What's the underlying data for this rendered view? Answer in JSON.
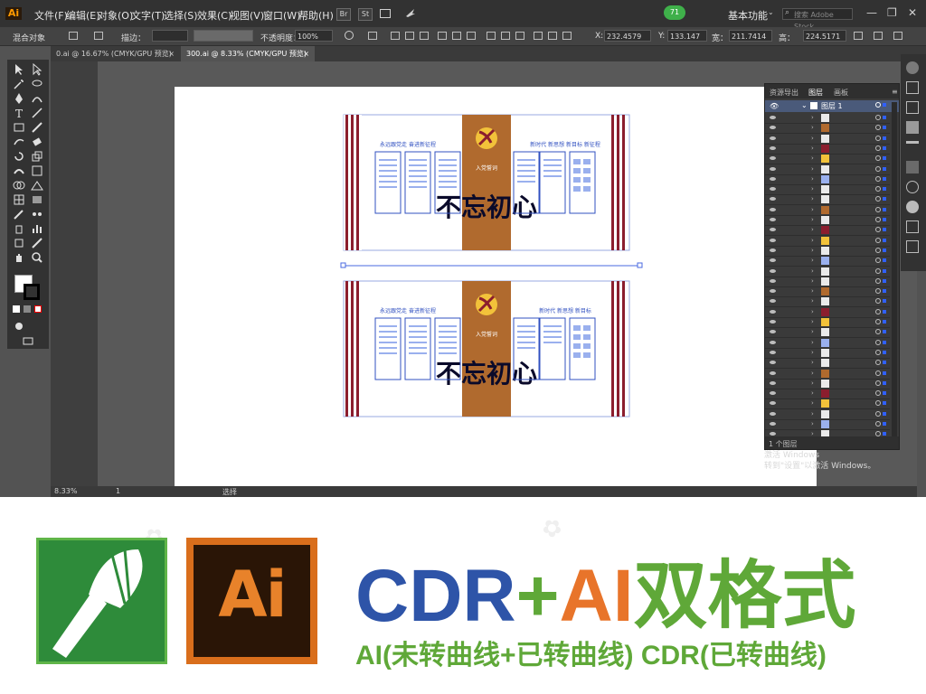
{
  "app": {
    "logo": "Ai"
  },
  "menubar": {
    "items": [
      "文件(F)",
      "编辑(E)",
      "对象(O)",
      "文字(T)",
      "选择(S)",
      "效果(C)",
      "视图(V)",
      "窗口(W)",
      "帮助(H)"
    ],
    "br_label": "Br",
    "st_label": "St",
    "badge": "71",
    "workspace": "基本功能",
    "search_placeholder": "搜索 Adobe Stock"
  },
  "control_bar": {
    "object_type": "混合对象",
    "stroke_label": "描边：",
    "opacity_label": "不透明度：",
    "opacity_value": "100%",
    "x_label": "X:",
    "x_value": "232.4579",
    "y_label": "Y:",
    "y_value": "133.147",
    "w_label": "宽：",
    "w_value": "211.7414",
    "h_label": "高：",
    "h_value": "224.5171"
  },
  "tabs": [
    {
      "label": "0.ai @ 16.67% (CMYK/GPU 预览)",
      "close": "×"
    },
    {
      "label": "300.ai @ 8.33% (CMYK/GPU 预览)",
      "close": "×"
    }
  ],
  "status_bar": {
    "zoom": "8.33%",
    "page": "1",
    "tool": "选择"
  },
  "layers_panel": {
    "tabs": [
      "资源导出",
      "图层",
      "画板"
    ],
    "layer_name": "图层 1",
    "footer": "1 个图层"
  },
  "activation": {
    "line1": "激活 Windows",
    "line2": "转到\"设置\"以激活 Windows。"
  },
  "artwork": {
    "top_left_heading": "永远跟党走 奋进新征程",
    "top_right_heading": "新时代 新思想 新目标 新征程",
    "bottom_left_heading": "永远跟党走 奋进新征程",
    "bottom_right_heading": "新时代 新思想 新目标",
    "center_title": "入党誓词",
    "center_calligraphy": "不忘初心"
  },
  "promo": {
    "ai_logo": "Ai",
    "headline_cdr": "CDR",
    "headline_plus": "+",
    "headline_ai": "AI",
    "headline_format": "双格式",
    "subline": "AI(未转曲线+已转曲线) CDR(已转曲线)"
  },
  "colors": {
    "menubar_bg": "#323232",
    "canvas_bg": "#595959",
    "cdr_blue": "#2e54a8",
    "accent_green": "#5fa838",
    "ai_orange": "#e8742a",
    "party_brown": "#b06a2e",
    "stripe_red": "#8b1e2e"
  }
}
